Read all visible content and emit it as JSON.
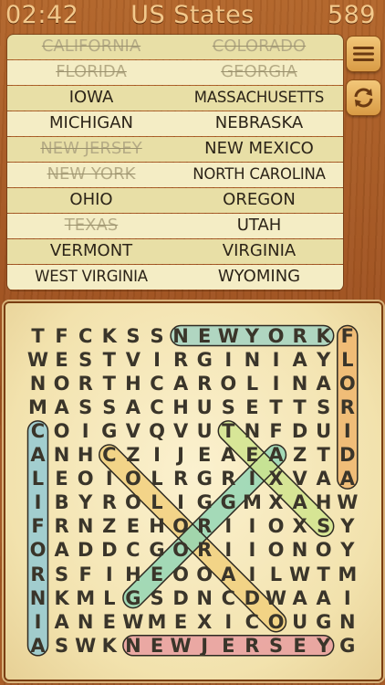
{
  "header": {
    "timer": "02:42",
    "title": "US States",
    "score": "589"
  },
  "words": [
    {
      "text": "CALIFORNIA",
      "found": true
    },
    {
      "text": "COLORADO",
      "found": true
    },
    {
      "text": "FLORIDA",
      "found": true
    },
    {
      "text": "GEORGIA",
      "found": true
    },
    {
      "text": "IOWA",
      "found": false
    },
    {
      "text": "MASSACHUSETTS",
      "found": false
    },
    {
      "text": "MICHIGAN",
      "found": false
    },
    {
      "text": "NEBRASKA",
      "found": false
    },
    {
      "text": "NEW JERSEY",
      "found": true
    },
    {
      "text": "NEW MEXICO",
      "found": false
    },
    {
      "text": "NEW YORK",
      "found": true
    },
    {
      "text": "NORTH CAROLINA",
      "found": false
    },
    {
      "text": "OHIO",
      "found": false
    },
    {
      "text": "OREGON",
      "found": false
    },
    {
      "text": "TEXAS",
      "found": true
    },
    {
      "text": "UTAH",
      "found": false
    },
    {
      "text": "VERMONT",
      "found": false
    },
    {
      "text": "VIRGINIA",
      "found": false
    },
    {
      "text": "WEST VIRGINIA",
      "found": false
    },
    {
      "text": "WYOMING",
      "found": false
    }
  ],
  "buttons": {
    "menu_icon": "hamburger-icon",
    "refresh_icon": "refresh-icon"
  },
  "grid": {
    "rows": [
      "TFCKSSNEWYORKF",
      "WESTVIRGINIAYL",
      "NORTHCAROLINAO",
      "MASSACHUSETTSR",
      "COIGVQVUTNFDUI",
      "ANHCZIJEAEAZTD",
      "LEOIOLRGRIXVAA",
      "IBYROLIGGMXAHW",
      "FRNZEHORIIOXSY",
      "OADDCGORIIONOYO",
      "RSFIHEOOAILWTM",
      "NKMLGSDNCDWAAI",
      "IANEWMEXICOUGN",
      "ASWKNEWJERSEYG"
    ],
    "highlights": [
      {
        "word": "NEWYORK",
        "start": [
          0,
          6
        ],
        "end": [
          0,
          12
        ],
        "color": "#9fd3c4"
      },
      {
        "word": "FLORIDA",
        "start": [
          0,
          13
        ],
        "end": [
          6,
          13
        ],
        "color": "#f0b46a"
      },
      {
        "word": "CALIFORNIA",
        "start": [
          4,
          0
        ],
        "end": [
          13,
          0
        ],
        "color": "#8ec9d7"
      },
      {
        "word": "NEWJERSEY",
        "start": [
          13,
          4
        ],
        "end": [
          13,
          12
        ],
        "color": "#e89aa0"
      },
      {
        "word": "COLORADO",
        "start": [
          5,
          3
        ],
        "end": [
          12,
          10
        ],
        "color": "#f2cf7a"
      },
      {
        "word": "GEORGIA",
        "start": [
          11,
          4
        ],
        "end": [
          5,
          10
        ],
        "color": "#8fd6b5"
      },
      {
        "word": "TEXAS",
        "start": [
          4,
          8
        ],
        "end": [
          8,
          12
        ],
        "color": "#cfe58c"
      }
    ]
  }
}
